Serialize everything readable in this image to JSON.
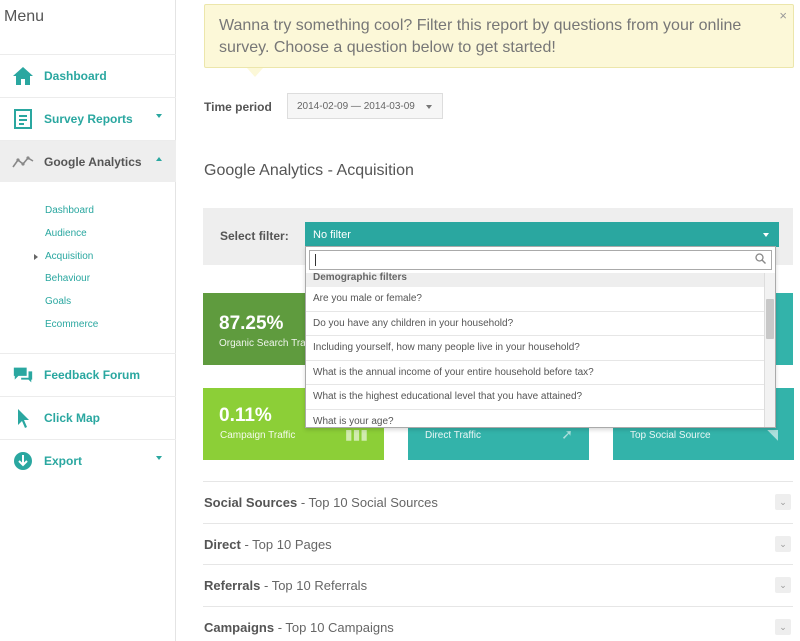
{
  "sidebar": {
    "menu_title": "Menu",
    "items": [
      {
        "label": "Dashboard",
        "icon": "home-icon"
      },
      {
        "label": "Survey Reports",
        "icon": "document-icon"
      },
      {
        "label": "Google Analytics",
        "icon": "analytics-icon"
      },
      {
        "label": "Feedback Forum",
        "icon": "chat-icon"
      },
      {
        "label": "Click Map",
        "icon": "cursor-icon"
      },
      {
        "label": "Export",
        "icon": "download-icon"
      }
    ],
    "sub_items": [
      "Dashboard",
      "Audience",
      "Acquisition",
      "Behaviour",
      "Goals",
      "Ecommerce"
    ]
  },
  "tip": {
    "text": "Wanna try something cool? Filter this report by questions from your online survey. Choose a question below to get started!",
    "close": "×"
  },
  "time_period": {
    "label": "Time period",
    "value": "2014-02-09 — 2014-03-09"
  },
  "section_title": "Google Analytics - Acquisition",
  "filter": {
    "label": "Select filter:",
    "value": "No filter",
    "group_label": "Demographic filters",
    "options": [
      "Are you male or female?",
      "Do you have any children in your household?",
      "Including yourself, how many people live in your household?",
      "What is the annual income of your entire household before tax?",
      "What is the highest educational level that you have attained?",
      "What is your age?"
    ]
  },
  "cards": [
    {
      "value": "87.25%",
      "caption": "Organic Search Tra"
    },
    {
      "value": "0.11%",
      "caption": "Campaign Traffic"
    },
    {
      "value": "",
      "caption": "Direct Traffic"
    },
    {
      "value": "",
      "caption": "Top Social Source"
    }
  ],
  "accordion": [
    {
      "bold": "Social Sources",
      "rest": " - Top 10 Social Sources"
    },
    {
      "bold": "Direct",
      "rest": " - Top 10 Pages"
    },
    {
      "bold": "Referrals",
      "rest": " - Top 10 Referrals"
    },
    {
      "bold": "Campaigns",
      "rest": " - Top 10 Campaigns"
    }
  ],
  "colors": {
    "accent": "#2aa7a0",
    "card_dark_green": "#5f9b3e",
    "card_green": "#8ccf37",
    "card_teal": "#33b3aa",
    "tip_bg": "#fcf8d8"
  }
}
